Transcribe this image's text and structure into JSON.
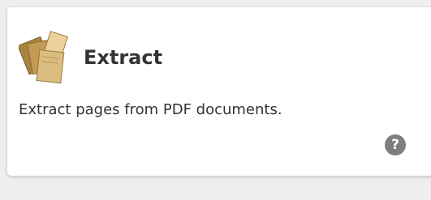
{
  "card": {
    "title": "Extract",
    "description": "Extract pages from PDF documents.",
    "icon": "extract-pages-icon",
    "help_icon": "help-icon",
    "help_glyph": "?"
  },
  "colors": {
    "card_background": "#ffffff",
    "page_background": "#eeeeee",
    "text": "#333333",
    "help_icon": "#7f7f7f",
    "icon_tan": "#d9b87a"
  }
}
